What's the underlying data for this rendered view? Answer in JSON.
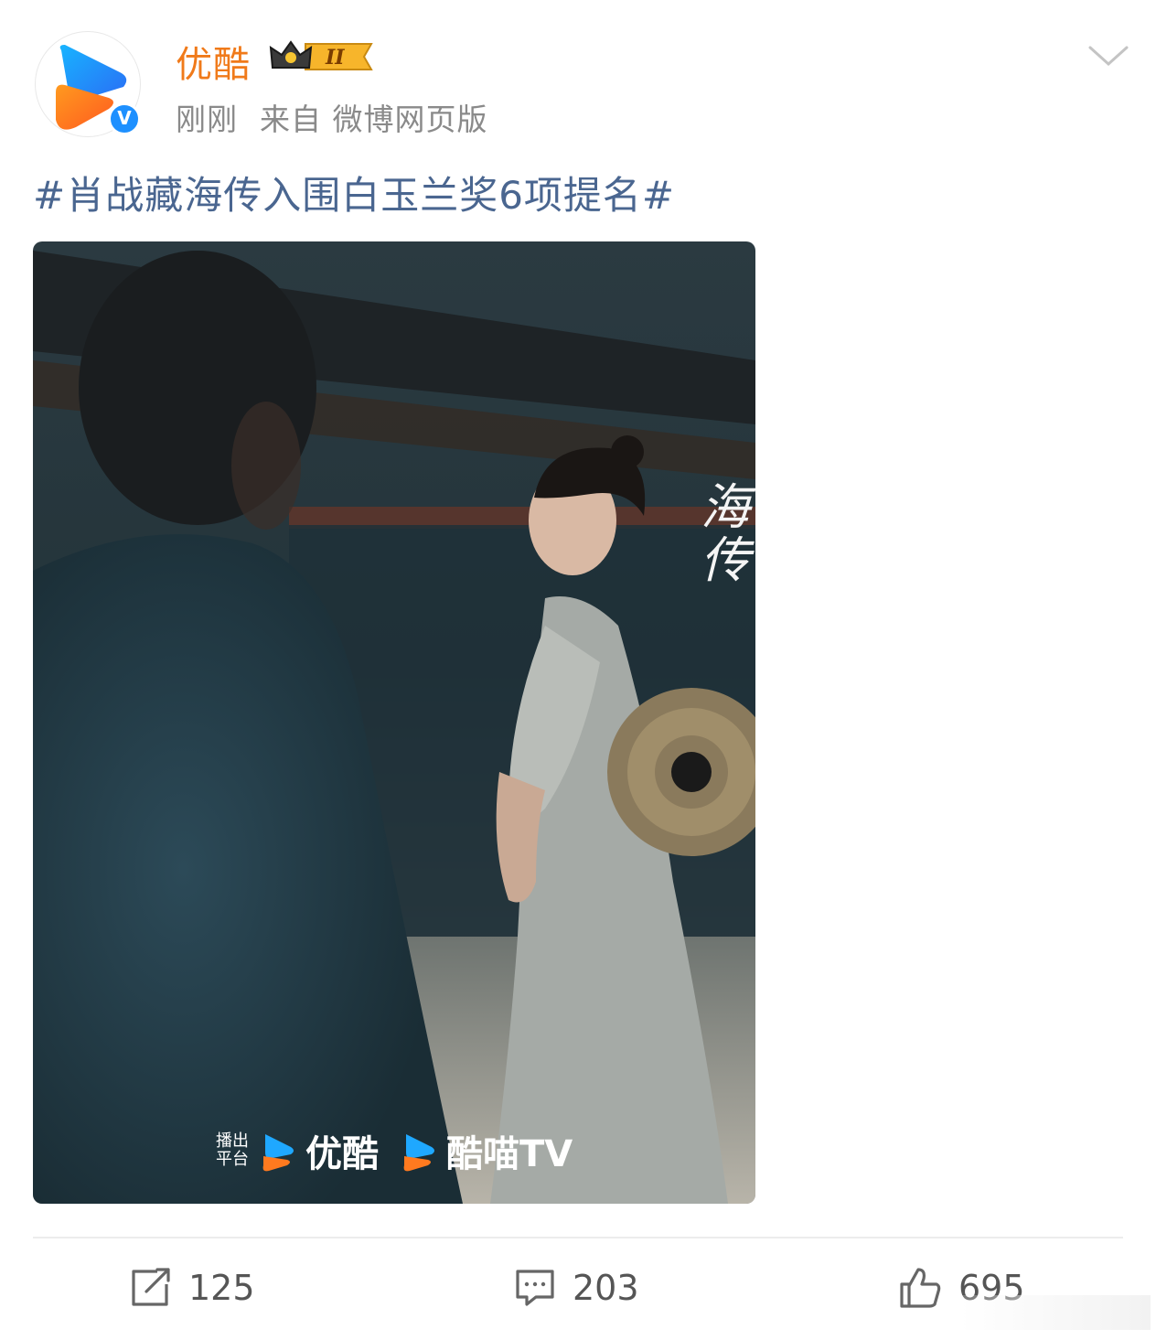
{
  "header": {
    "username": "优酷",
    "vip_level": "II",
    "time": "刚刚",
    "source": "来自 微博网页版",
    "avatar_icon": "youku-logo-icon",
    "verified_icon": "verified-v-icon",
    "menu_icon": "chevron-down-icon"
  },
  "post": {
    "text": "#肖战藏海传入围白玉兰奖6项提名#"
  },
  "image": {
    "title_text": "海传",
    "platform_label": "播出平台",
    "platforms": [
      "优酷",
      "酷喵TV"
    ]
  },
  "actions": {
    "repost_count": "125",
    "comment_count": "203",
    "like_count": "695"
  },
  "colors": {
    "username": "#f07a1a",
    "topic": "#4a6690",
    "meta": "#8a8a8a",
    "accent_blue": "#1e90ff"
  }
}
